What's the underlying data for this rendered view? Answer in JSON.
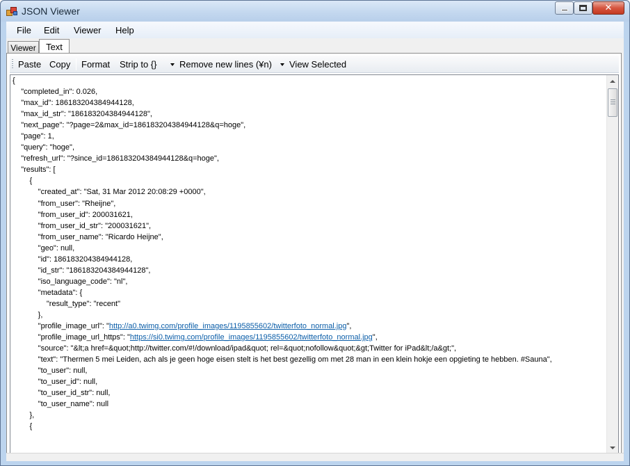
{
  "window": {
    "title": "JSON Viewer",
    "controls": {
      "minimize_icon": "minimize-icon",
      "maximize_icon": "maximize-icon",
      "close_icon": "close-icon"
    }
  },
  "menu": {
    "file": "File",
    "edit": "Edit",
    "viewer": "Viewer",
    "help": "Help"
  },
  "tabs": {
    "viewer": "Viewer",
    "text": "Text",
    "active": "Text"
  },
  "toolbar": {
    "paste": "Paste",
    "copy": "Copy",
    "format": "Format",
    "strip": "Strip to {}",
    "remove_newlines": "Remove new lines (¥n)",
    "view_selected": "View Selected"
  },
  "editor": {
    "lines": [
      "{",
      "    \"completed_in\": 0.026,",
      "    \"max_id\": 186183204384944128,",
      "    \"max_id_str\": \"186183204384944128\",",
      "    \"next_page\": \"?page=2&max_id=186183204384944128&q=hoge\",",
      "    \"page\": 1,",
      "    \"query\": \"hoge\",",
      "    \"refresh_url\": \"?since_id=186183204384944128&q=hoge\",",
      "    \"results\": [",
      "        {",
      "            \"created_at\": \"Sat, 31 Mar 2012 20:08:29 +0000\",",
      "            \"from_user\": \"Rheijne\",",
      "            \"from_user_id\": 200031621,",
      "            \"from_user_id_str\": \"200031621\",",
      "            \"from_user_name\": \"Ricardo Heijne\",",
      "            \"geo\": null,",
      "            \"id\": 186183204384944128,",
      "            \"id_str\": \"186183204384944128\",",
      "            \"iso_language_code\": \"nl\",",
      "            \"metadata\": {",
      "                \"result_type\": \"recent\"",
      "            },",
      "            \"profile_image_url\": \"",
      "            \"profile_image_url_https\": \"",
      "            \"source\": \"&lt;a href=&quot;http://twitter.com/#!/download/ipad&quot; rel=&quot;nofollow&quot;&gt;Twitter for iPad&lt;/a&gt;\",",
      "            \"text\": \"Thermen 5 mei Leiden, ach als je geen hoge eisen stelt is het best gezellig om met 28 man in een klein hokje een opgieting te hebben. #Sauna\",",
      "            \"to_user\": null,",
      "            \"to_user_id\": null,",
      "            \"to_user_id_str\": null,",
      "            \"to_user_name\": null",
      "        },",
      "        {"
    ],
    "link_profile_image_url": "http://a0.twimg.com/profile_images/1195855602/twitterfoto_normal.jpg",
    "link_profile_image_url_https": "https://si0.twimg.com/profile_images/1195855602/twitterfoto_normal.jpg",
    "link_suffix": "\","
  }
}
